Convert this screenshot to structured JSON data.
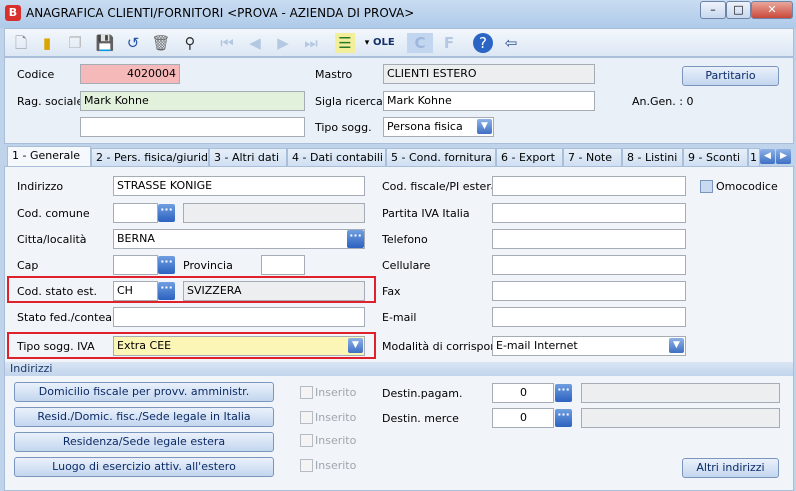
{
  "window": {
    "title": "ANAGRAFICA CLIENTI/FORNITORI <PROVA - AZIENDA DI PROVA>",
    "logo": "B"
  },
  "toolbar": {
    "icons": [
      "new-icon",
      "open-folder-icon",
      "copy-icon",
      "save-icon",
      "undo-icon",
      "delete-icon",
      "binoculars-icon",
      "first-icon",
      "prev-icon",
      "next-icon",
      "last-icon",
      "list-icon",
      "ole-icon",
      "c-icon",
      "f-icon",
      "help-icon",
      "exit-icon"
    ],
    "ole_label": "OLE"
  },
  "header": {
    "codice_label": "Codice",
    "codice_value": "4020004",
    "mastro_label": "Mastro",
    "mastro_value": "CLIENTI ESTERO",
    "partitario_button": "Partitario",
    "rag_sociale_label": "Rag. sociale",
    "rag_sociale_value": "Mark Kohne",
    "sigla_label": "Sigla ricerca",
    "sigla_value": "Mark Kohne",
    "angen_label": "An.Gen. : 0",
    "rag_sociale2_value": "",
    "tipo_sogg_label": "Tipo sogg.",
    "tipo_sogg_value": "Persona fisica"
  },
  "tabs": [
    {
      "label": "1 - Generale",
      "active": true
    },
    {
      "label": "2 - Pers. fisica/giurid."
    },
    {
      "label": "3 - Altri dati"
    },
    {
      "label": "4 - Dati contabili"
    },
    {
      "label": "5 - Cond. fornitura"
    },
    {
      "label": "6 - Export"
    },
    {
      "label": "7 - Note"
    },
    {
      "label": "8 - Listini"
    },
    {
      "label": "9 - Sconti"
    },
    {
      "label": "1"
    }
  ],
  "general": {
    "indirizzo_label": "Indirizzo",
    "indirizzo_value": "STRASSE KONIGE",
    "cod_comune_label": "Cod. comune",
    "cod_comune_value": "",
    "comune_desc": "",
    "citta_label": "Citta/località",
    "citta_value": "BERNA",
    "cap_label": "Cap",
    "cap_value": "",
    "provincia_label": "Provincia",
    "provincia_value": "",
    "cod_stato_label": "Cod. stato est.",
    "cod_stato_value": "CH",
    "stato_desc": "SVIZZERA",
    "stato_fed_label": "Stato fed./contea",
    "stato_fed_value": "",
    "tipo_iva_label": "Tipo sogg. IVA",
    "tipo_iva_value": "Extra CEE",
    "cf_estera_label": "Cod. fiscale/PI estera",
    "piva_label": "Partita IVA Italia",
    "telefono_label": "Telefono",
    "cellulare_label": "Cellulare",
    "fax_label": "Fax",
    "email_label": "E-mail",
    "modalita_label": "Modalità di corrispond.",
    "modalita_value": "E-mail Internet",
    "omocodice_label": "Omocodice"
  },
  "indirizzi": {
    "section_label": "Indirizzi",
    "buttons": [
      "Domicilio fiscale per provv. amministr.",
      "Resid./Domic. fisc./Sede legale in Italia",
      "Residenza/Sede legale estera",
      "Luogo di esercizio attiv. all'estero"
    ],
    "inserito_label": "Inserito",
    "destin_pagam_label": "Destin.pagam.",
    "destin_pagam_value": "0",
    "destin_merce_label": "Destin. merce",
    "destin_merce_value": "0",
    "altri_button": "Altri indirizzi"
  }
}
